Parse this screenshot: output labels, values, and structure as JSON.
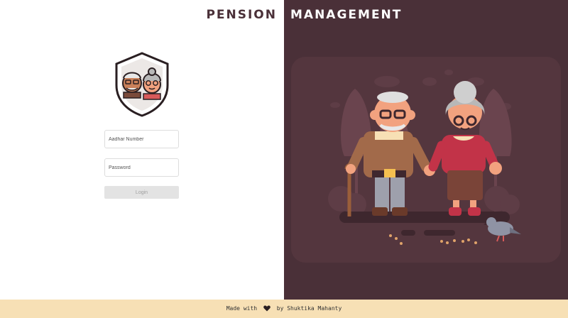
{
  "header": {
    "title_left": "PENSION",
    "title_right": "MANAGEMENT"
  },
  "logo": {
    "icon": "elderly-couple-shield-icon"
  },
  "form": {
    "aadhar_placeholder": "Aadhar Number",
    "password_placeholder": "Password",
    "login_label": "Login"
  },
  "illustration": {
    "icon": "elderly-couple-illustration"
  },
  "footer": {
    "prefix": "Made with",
    "icon": "heart-icon",
    "suffix": "by Shuktika Mahanty"
  },
  "colors": {
    "dark_panel": "#4a3038",
    "footer_bg": "#f7e0b5",
    "accent": "#4a3038"
  }
}
